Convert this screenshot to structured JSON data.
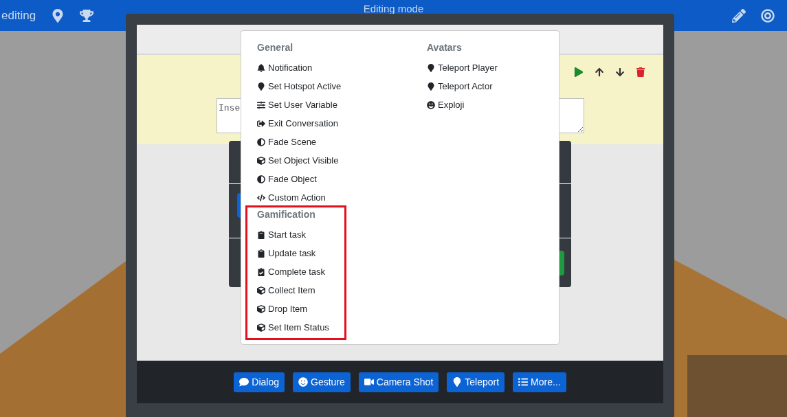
{
  "top_bar": {
    "left_label": "editing",
    "title": "Editing mode"
  },
  "editor": {
    "textarea": {
      "placeholder": "Inse"
    }
  },
  "menu": {
    "columns": [
      {
        "sections": [
          {
            "heading": "General",
            "highlighted": false,
            "items": [
              {
                "label": "Notification",
                "kind": "bell"
              },
              {
                "label": "Set Hotspot Active",
                "kind": "marker"
              },
              {
                "label": "Set User Variable",
                "kind": "sliders"
              },
              {
                "label": "Exit Conversation",
                "kind": "exit"
              },
              {
                "label": "Fade Scene",
                "kind": "half"
              },
              {
                "label": "Set Object Visible",
                "kind": "cube"
              },
              {
                "label": "Fade Object",
                "kind": "half"
              },
              {
                "label": "Custom Action",
                "kind": "code"
              }
            ]
          },
          {
            "heading": "Gamification",
            "highlighted": true,
            "items": [
              {
                "label": "Start task",
                "kind": "clipboard"
              },
              {
                "label": "Update task",
                "kind": "clipboard"
              },
              {
                "label": "Complete task",
                "kind": "checked"
              },
              {
                "label": "Collect Item",
                "kind": "cube"
              },
              {
                "label": "Drop Item",
                "kind": "cube"
              },
              {
                "label": "Set Item Status",
                "kind": "cube"
              }
            ]
          }
        ]
      },
      {
        "sections": [
          {
            "heading": "Avatars",
            "highlighted": false,
            "items": [
              {
                "label": "Teleport Player",
                "kind": "marker"
              },
              {
                "label": "Teleport Actor",
                "kind": "marker"
              },
              {
                "label": "Exploji",
                "kind": "grin"
              }
            ]
          }
        ]
      }
    ]
  },
  "bottom_buttons": [
    {
      "label": "Dialog",
      "kind": "comment"
    },
    {
      "label": "Gesture",
      "kind": "smile"
    },
    {
      "label": "Camera Shot",
      "kind": "video"
    },
    {
      "label": "Teleport",
      "kind": "marker"
    },
    {
      "label": "More...",
      "kind": "list"
    }
  ]
}
